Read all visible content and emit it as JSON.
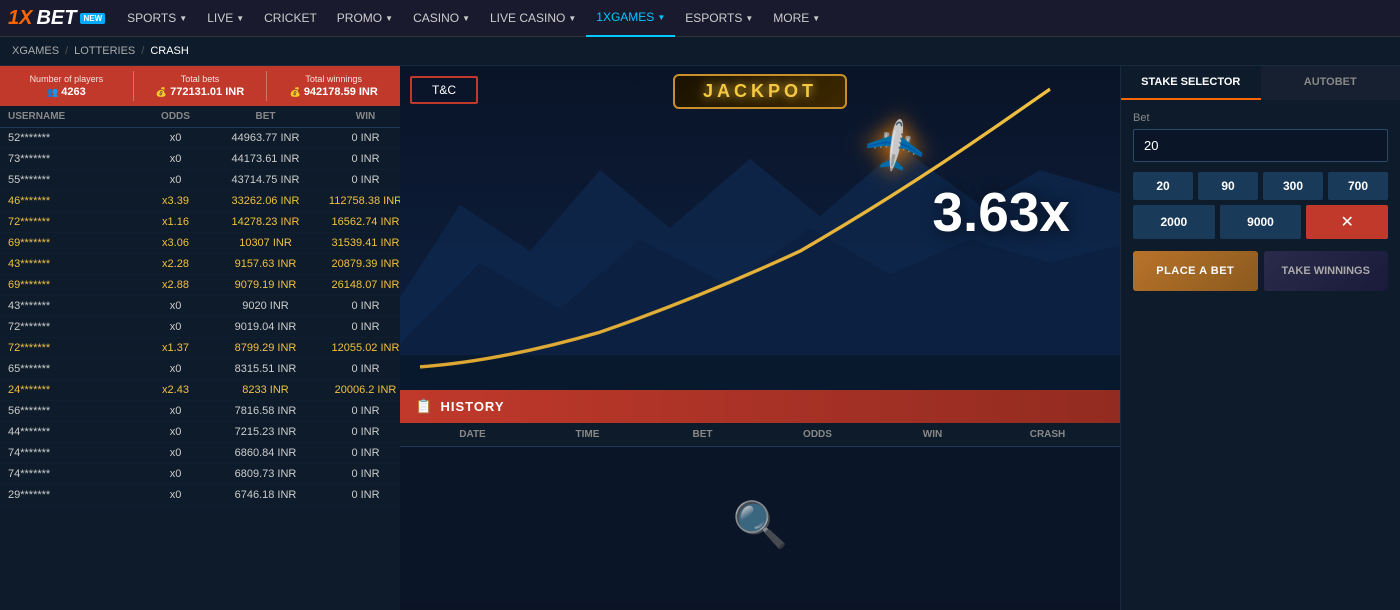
{
  "nav": {
    "logo": "1XBET",
    "logo_badge": "NEW",
    "items": [
      {
        "label": "SPORTS",
        "has_arrow": true,
        "active": false
      },
      {
        "label": "LIVE",
        "has_arrow": true,
        "active": false
      },
      {
        "label": "CRICKET",
        "has_arrow": false,
        "active": false
      },
      {
        "label": "PROMO",
        "has_arrow": true,
        "active": false
      },
      {
        "label": "CASINO",
        "has_arrow": true,
        "active": false
      },
      {
        "label": "LIVE CASINO",
        "has_arrow": true,
        "active": false
      },
      {
        "label": "1XGAMES",
        "has_arrow": true,
        "active": true
      },
      {
        "label": "ESPORTS",
        "has_arrow": true,
        "active": false
      },
      {
        "label": "MORE",
        "has_arrow": true,
        "active": false
      }
    ]
  },
  "breadcrumb": {
    "items": [
      "XGAMES",
      "LOTTERIES",
      "CRASH"
    ]
  },
  "stats": {
    "players_label": "Number of players",
    "players_value": "4263",
    "bets_label": "Total bets",
    "bets_value": "772131.01 INR",
    "winnings_label": "Total winnings",
    "winnings_value": "942178.59 INR"
  },
  "table": {
    "headers": [
      "USERNAME",
      "ODDS",
      "BET",
      "WIN"
    ],
    "rows": [
      {
        "username": "52*******",
        "odds": "x0",
        "bet": "44963.77 INR",
        "win": "0 INR",
        "won": false
      },
      {
        "username": "73*******",
        "odds": "x0",
        "bet": "44173.61 INR",
        "win": "0 INR",
        "won": false
      },
      {
        "username": "55*******",
        "odds": "x0",
        "bet": "43714.75 INR",
        "win": "0 INR",
        "won": false
      },
      {
        "username": "46*******",
        "odds": "x3.39",
        "bet": "33262.06 INR",
        "win": "112758.38 INR",
        "won": true
      },
      {
        "username": "72*******",
        "odds": "x1.16",
        "bet": "14278.23 INR",
        "win": "16562.74 INR",
        "won": true
      },
      {
        "username": "69*******",
        "odds": "x3.06",
        "bet": "10307 INR",
        "win": "31539.41 INR",
        "won": true
      },
      {
        "username": "43*******",
        "odds": "x2.28",
        "bet": "9157.63 INR",
        "win": "20879.39 INR",
        "won": true
      },
      {
        "username": "69*******",
        "odds": "x2.88",
        "bet": "9079.19 INR",
        "win": "26148.07 INR",
        "won": true
      },
      {
        "username": "43*******",
        "odds": "x0",
        "bet": "9020 INR",
        "win": "0 INR",
        "won": false
      },
      {
        "username": "72*******",
        "odds": "x0",
        "bet": "9019.04 INR",
        "win": "0 INR",
        "won": false
      },
      {
        "username": "72*******",
        "odds": "x1.37",
        "bet": "8799.29 INR",
        "win": "12055.02 INR",
        "won": true
      },
      {
        "username": "65*******",
        "odds": "x0",
        "bet": "8315.51 INR",
        "win": "0 INR",
        "won": false
      },
      {
        "username": "24*******",
        "odds": "x2.43",
        "bet": "8233 INR",
        "win": "20006.2 INR",
        "won": true
      },
      {
        "username": "56*******",
        "odds": "x0",
        "bet": "7816.58 INR",
        "win": "0 INR",
        "won": false
      },
      {
        "username": "44*******",
        "odds": "x0",
        "bet": "7215.23 INR",
        "win": "0 INR",
        "won": false
      },
      {
        "username": "74*******",
        "odds": "x0",
        "bet": "6860.84 INR",
        "win": "0 INR",
        "won": false
      },
      {
        "username": "74*******",
        "odds": "x0",
        "bet": "6809.73 INR",
        "win": "0 INR",
        "won": false
      },
      {
        "username": "29*******",
        "odds": "x0",
        "bet": "6746.18 INR",
        "win": "0 INR",
        "won": false
      }
    ]
  },
  "jackpot": "JACKPOT",
  "tc_button": "T&C",
  "multiplier": "3.63x",
  "history": {
    "title": "HISTORY",
    "headers": [
      "DATE",
      "TIME",
      "BET",
      "ODDS",
      "WIN",
      "CRASH"
    ]
  },
  "stake": {
    "tab_stake": "STAKE SELECTOR",
    "tab_autobet": "AUTOBET",
    "bet_label": "Bet",
    "bet_value": "20",
    "quick_bets": [
      "20",
      "90",
      "300",
      "700"
    ],
    "quick_bets_2": [
      "2000",
      "9000"
    ],
    "place_bet": "PLACE A BET",
    "take_winnings": "TAKE WINNINGS"
  }
}
